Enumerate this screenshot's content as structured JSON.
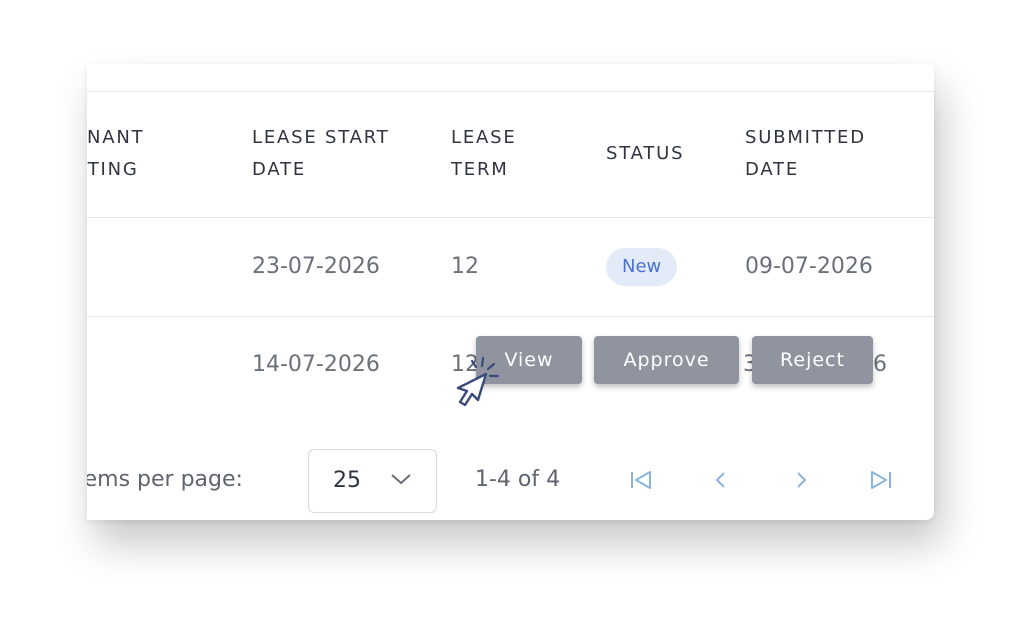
{
  "table": {
    "columns": {
      "tenant_rating_line1": "NANT",
      "tenant_rating_line2": "ATING",
      "lease_start_line1": "LEASE START",
      "lease_start_line2": "DATE",
      "lease_term_line1": "LEASE",
      "lease_term_line2": "TERM",
      "status": "STATUS",
      "submitted_line1": "SUBMITTED",
      "submitted_line2": "DATE"
    },
    "rows": [
      {
        "lease_start": "23-07-2026",
        "lease_term": "12",
        "status": "New",
        "submitted": "09-07-2026"
      },
      {
        "lease_start": "14-07-2026",
        "lease_term": "12",
        "submitted_left": "3",
        "submitted_right": "6"
      }
    ]
  },
  "row_actions": {
    "view": "View",
    "approve": "Approve",
    "reject": "Reject"
  },
  "pagination": {
    "items_per_page_label": "tems per page:",
    "page_size": "25",
    "range": "1-4 of 4"
  },
  "colors": {
    "accent": "#8ab4dd",
    "badge_text": "#4a73c9",
    "badge_bg": "#e3ebf8",
    "action_bg": "#8f949e"
  },
  "icons": [
    "chevron-down-icon",
    "first-page-icon",
    "previous-page-icon",
    "next-page-icon",
    "last-page-icon",
    "pointer-cursor-icon"
  ]
}
